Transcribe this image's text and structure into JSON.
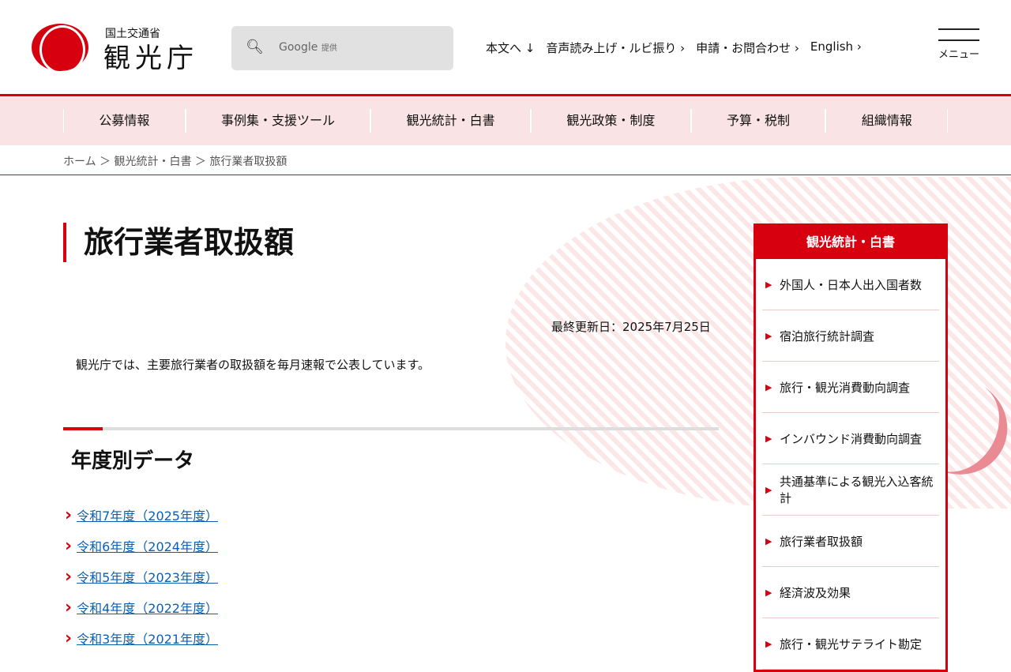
{
  "header": {
    "ministry": "国土交通省",
    "agency": "観光庁",
    "search_label": "Google",
    "search_sub": "提供",
    "utils": [
      "本文へ ↓",
      "音声読み上げ・ルビ振り ›",
      "申請・お問合わせ ›",
      "English ›"
    ],
    "menu_label": "メニュー"
  },
  "gnav": [
    "公募情報",
    "事例集・支援ツール",
    "観光統計・白書",
    "観光政策・制度",
    "予算・税制",
    "組織情報"
  ],
  "breadcrumb": "ホーム ＞ 観光統計・白書 ＞ 旅行業者取扱額",
  "main": {
    "title": "旅行業者取扱額",
    "updated": "最終更新日：2025年7月25日",
    "intro": "観光庁では、主要旅行業者の取扱額を毎月速報で公表しています。",
    "section": "年度別データ",
    "links": [
      "令和7年度（2025年度）",
      "令和6年度（2024年度）",
      "令和5年度（2023年度）",
      "令和4年度（2022年度）",
      "令和3年度（2021年度）"
    ]
  },
  "side": {
    "title": "観光統計・白書",
    "items": [
      "外国人・日本人出入国者数",
      "宿泊旅行統計調査",
      "旅行・観光消費動向調査",
      "インバウンド消費動向調査",
      "共通基準による観光入込客統計",
      "旅行業者取扱額",
      "経済波及効果",
      "旅行・観光サテライト勘定"
    ]
  },
  "colors": {
    "brand": "#d7000f",
    "link": "#0a5fb4"
  }
}
